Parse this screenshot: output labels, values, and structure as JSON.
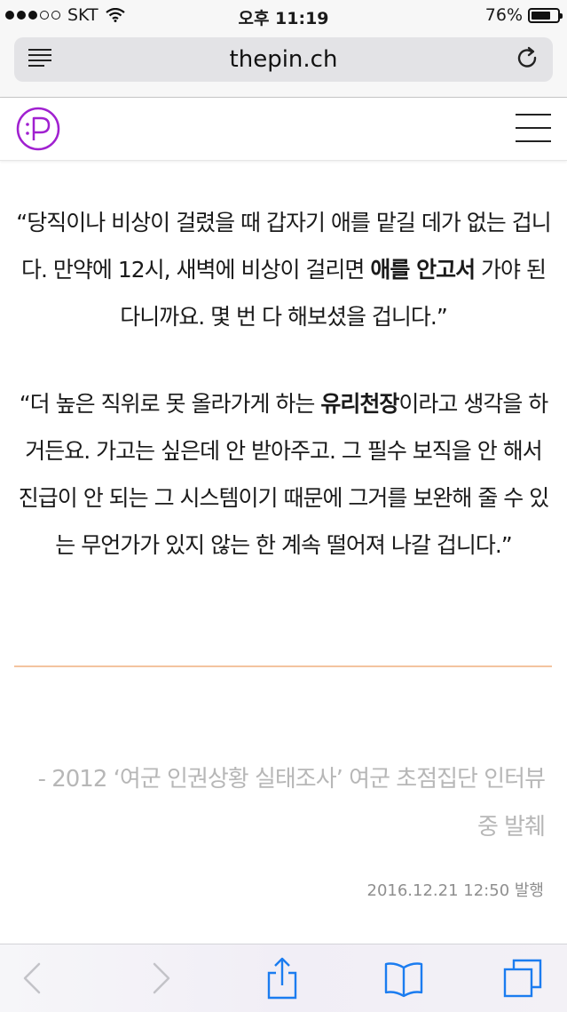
{
  "status_bar": {
    "carrier": "SKT",
    "time": "오후 11:19",
    "battery_text": "76%",
    "battery_level": 0.76,
    "signal_bars_filled": 3,
    "signal_bars_total": 5
  },
  "browser": {
    "url": "thepin.ch"
  },
  "article": {
    "quote1": {
      "before": "“당직이나 비상이 걸렸을 때 갑자기 애를 맡길 데가 없는 겁니다. 만약에 12시, 새벽에 비상이 걸리면 ",
      "bold": "애를 안고서",
      "after": " 가야 된다니까요. 몇 번 다 해보셨을 겁니다.”"
    },
    "quote2": {
      "before": "“더 높은 직위로 못 올라가게 하는 ",
      "bold": "유리천장",
      "after": "이라고 생각을 하거든요. 가고는 싶은데 안 받아주고. 그 필수 보직을 안 해서 진급이 안 되는 그 시스템이기 때문에 그거를 보완해 줄 수 있는 무언가가 있지 않는 한 계속 떨어져 나갈 겁니다.”"
    },
    "source": "- 2012 ‘여군 인권상황 실태조사’ 여군 초점집단 인터뷰 중 발췌",
    "date": "2016.12.21 12:50 발행"
  },
  "colors": {
    "logo_purple": "#a020d0",
    "divider": "#f3c49f",
    "toolbar_blue": "#1b7cf0",
    "toolbar_disabled": "#c3c3c8"
  },
  "icons": {
    "reader": "reader-mode-icon",
    "reload": "reload-icon",
    "menu": "hamburger-menu-icon",
    "back": "back-chevron-icon",
    "forward": "forward-chevron-icon",
    "share": "share-icon",
    "bookmarks": "bookmarks-icon",
    "tabs": "tabs-icon"
  }
}
